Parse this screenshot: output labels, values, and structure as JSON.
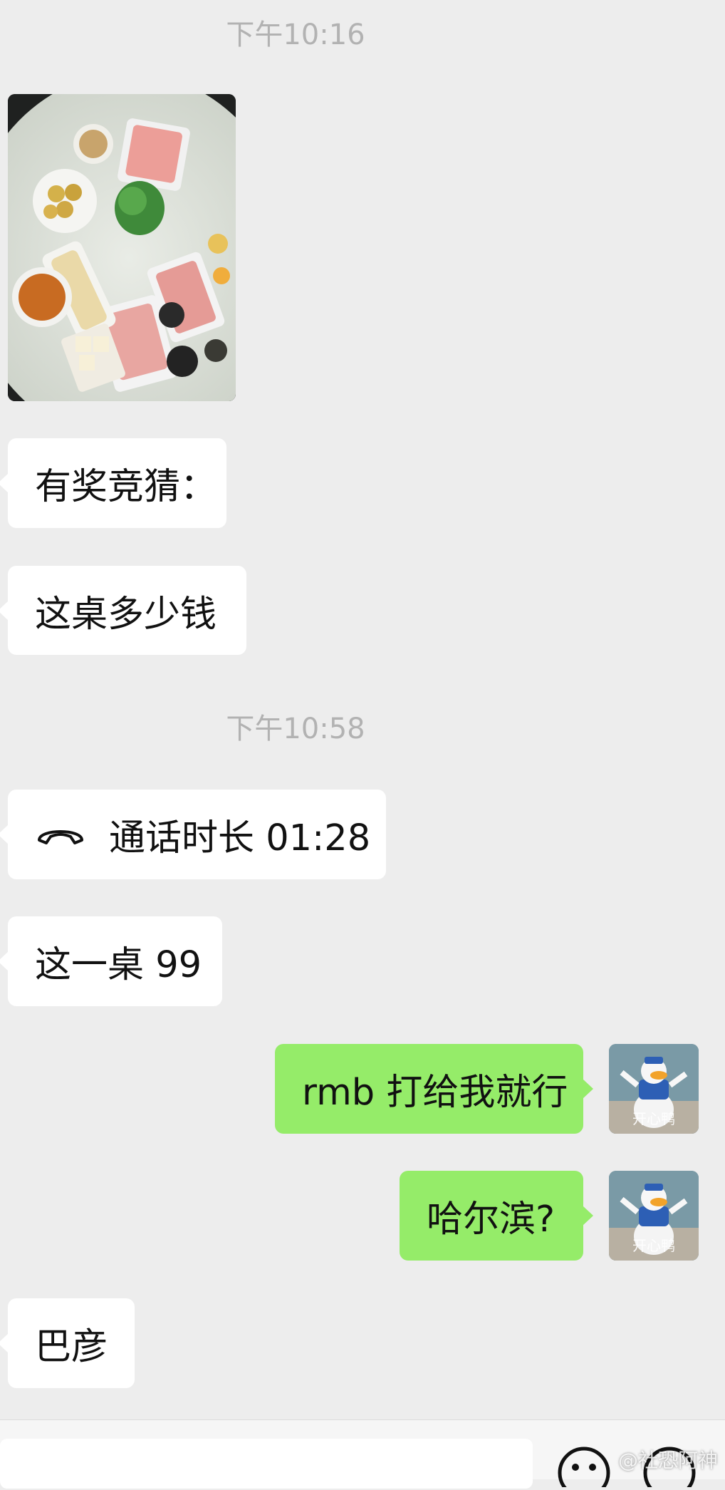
{
  "messages": {
    "timestamp_1": "下午10:16",
    "guess_prompt": "有奖竞猜：",
    "question": "这桌多少钱",
    "timestamp_2": "下午10:58",
    "call_label": "通话时长 01:28",
    "answer": "这一桌 99",
    "reply_1": "rmb 打给我就行",
    "reply_2": "哈尔滨?",
    "location": "巴彦"
  },
  "avatar": {
    "label": "开心鸭"
  },
  "watermark": "@社恐阿神",
  "colors": {
    "background": "#ededed",
    "incoming_bubble": "#ffffff",
    "outgoing_bubble": "#95ec69",
    "timestamp": "#b2b2b2"
  },
  "icons": {
    "call": "phone-handset-icon",
    "voice": "voice-icon",
    "emoji": "emoji-icon"
  }
}
